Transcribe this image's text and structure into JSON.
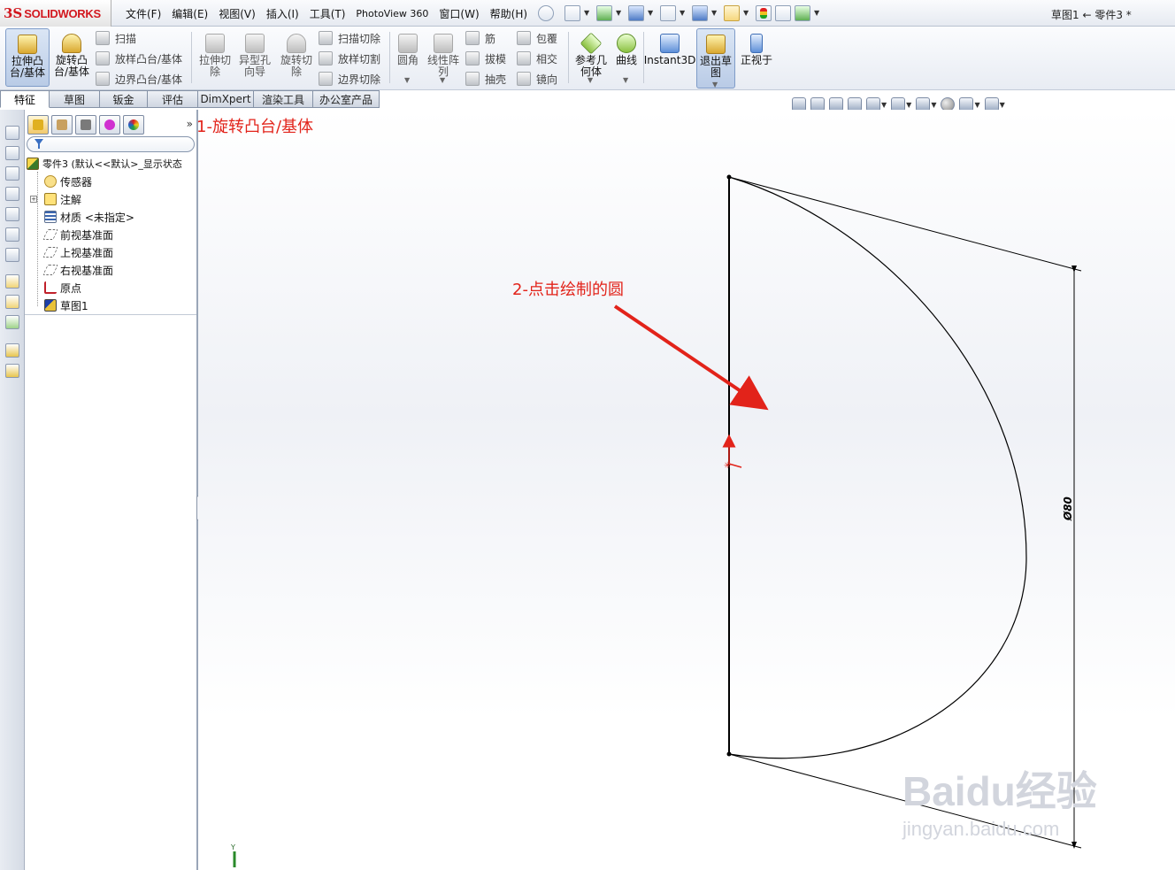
{
  "app": {
    "logo_mark": "3S",
    "logo_text": "SOLIDWORKS",
    "window_title": "草图1 ← 零件3 *"
  },
  "menu": [
    "文件(F)",
    "编辑(E)",
    "视图(V)",
    "插入(I)",
    "工具(T)",
    "PhotoView 360",
    "窗口(W)",
    "帮助(H)"
  ],
  "command_manager": {
    "extrude_boss": "拉伸凸台/基体",
    "revolve_boss": "旋转凸台/基体",
    "sweep": "扫描",
    "loft_boss": "放样凸台/基体",
    "boundary_boss": "边界凸台/基体",
    "extrude_cut": "拉伸切除",
    "hole_wizard": "异型孔向导",
    "revolve_cut": "旋转切除",
    "swept_cut": "扫描切除",
    "lofted_cut": "放样切割",
    "boundary_cut": "边界切除",
    "fillet": "圆角",
    "linear_pattern": "线性阵列",
    "rib": "筋",
    "draft": "拔模",
    "shell": "抽壳",
    "wrap": "包覆",
    "intersect": "相交",
    "mirror": "镜向",
    "ref_geometry": "参考几何体",
    "curves": "曲线",
    "instant3d": "Instant3D",
    "exit_sketch": "退出草图",
    "normal_to": "正视于"
  },
  "tabs": [
    "特征",
    "草图",
    "钣金",
    "评估",
    "DimXpert",
    "渲染工具",
    "办公室产品"
  ],
  "feature_tree": {
    "root": "零件3 (默认<<默认>_显示状态",
    "items": [
      "传感器",
      "注解",
      "材质 <未指定>",
      "前视基准面",
      "上视基准面",
      "右视基准面",
      "原点",
      "草图1"
    ]
  },
  "sketch": {
    "dimension": "Ø80",
    "triad_axis": "Y"
  },
  "annotations": {
    "step1": "1-旋转凸台/基体",
    "step2": "2-点击绘制的圆",
    "arrow_color": "#e2231a"
  },
  "watermark": {
    "brand": "Baidu经验",
    "url": "jingyan.baidu.com"
  }
}
